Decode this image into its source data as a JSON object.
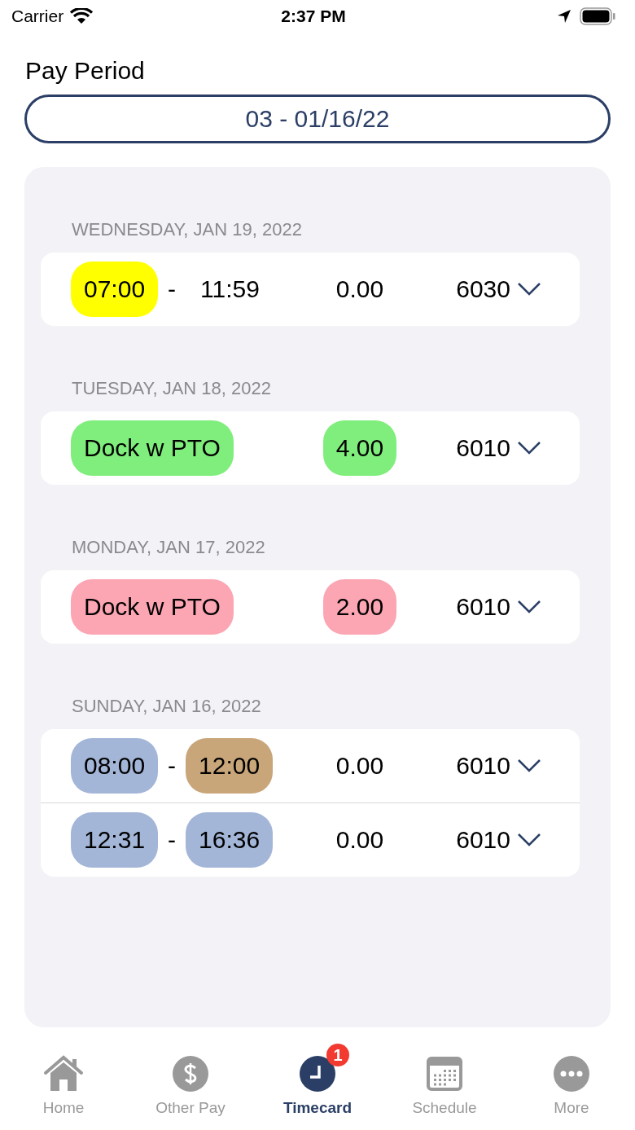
{
  "status_bar": {
    "carrier": "Carrier",
    "time": "2:37 PM"
  },
  "pay_period": {
    "label": "Pay Period",
    "value": "03 - 01/16/22"
  },
  "days": [
    {
      "date": "WEDNESDAY, JAN 19, 2022",
      "entries": [
        {
          "kind": "range",
          "start": {
            "text": "07:00",
            "color": "#ffff00"
          },
          "separator": "-",
          "end": {
            "text": "11:59"
          },
          "hours": {
            "text": "0.00"
          },
          "code": "6030",
          "expanded": false
        }
      ]
    },
    {
      "date": "TUESDAY, JAN 18, 2022",
      "entries": [
        {
          "kind": "pay",
          "label": {
            "text": "Dock w PTO",
            "color": "#80ee7c"
          },
          "hours": {
            "text": "4.00",
            "color": "#80ee7c"
          },
          "code": "6010",
          "expanded": false
        }
      ]
    },
    {
      "date": "MONDAY, JAN 17, 2022",
      "entries": [
        {
          "kind": "pay",
          "label": {
            "text": "Dock w PTO",
            "color": "#fca5b3"
          },
          "hours": {
            "text": "2.00",
            "color": "#fca5b3"
          },
          "code": "6010",
          "expanded": false
        }
      ]
    },
    {
      "date": "SUNDAY, JAN 16, 2022",
      "entries": [
        {
          "kind": "range",
          "start": {
            "text": "08:00",
            "color": "#a3b6d8"
          },
          "separator": "-",
          "end": {
            "text": "12:00",
            "color": "#c8a67a"
          },
          "hours": {
            "text": "0.00"
          },
          "code": "6010",
          "expanded": false
        },
        {
          "kind": "range",
          "start": {
            "text": "12:31",
            "color": "#a3b6d8"
          },
          "separator": "-",
          "end": {
            "text": "16:36",
            "color": "#a3b6d8"
          },
          "hours": {
            "text": "0.00"
          },
          "code": "6010",
          "expanded": false
        }
      ]
    }
  ],
  "tabs": [
    {
      "kind": "home",
      "label": "Home",
      "selected": false
    },
    {
      "kind": "pay",
      "label": "Other Pay",
      "selected": false
    },
    {
      "kind": "timecard",
      "label": "Timecard",
      "selected": true,
      "badge": "1"
    },
    {
      "kind": "schedule",
      "label": "Schedule",
      "selected": false
    },
    {
      "kind": "more",
      "label": "More",
      "selected": false
    }
  ]
}
